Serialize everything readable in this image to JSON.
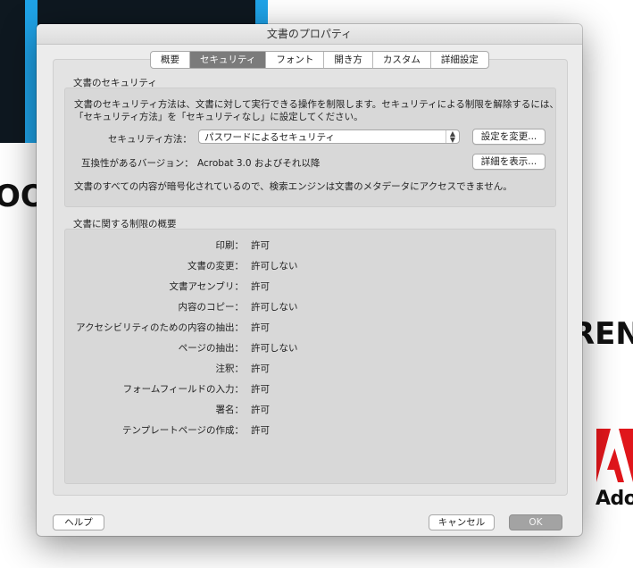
{
  "background": {
    "left_text": "OO",
    "right_text": "REN",
    "adobe_text": "Ado"
  },
  "dialog": {
    "title": "文書のプロパティ",
    "tabs": [
      {
        "label": "概要"
      },
      {
        "label": "セキュリティ",
        "active": true
      },
      {
        "label": "フォント"
      },
      {
        "label": "開き方"
      },
      {
        "label": "カスタム"
      },
      {
        "label": "詳細設定"
      }
    ],
    "security": {
      "heading": "文書のセキュリティ",
      "description_line1": "文書のセキュリティ方法は、文書に対して実行できる操作を制限します。セキュリティによる制限を解除するには、",
      "description_line2": "「セキュリティ方法」を「セキュリティなし」に設定してください。",
      "method_label": "セキュリティ方法：",
      "method_value": "パスワードによるセキュリティ",
      "change_settings_button": "設定を変更...",
      "compat_label": "互換性があるバージョン：",
      "compat_value": "Acrobat 3.0 およびそれ以降",
      "show_details_button": "詳細を表示...",
      "encryption_note": "文書のすべての内容が暗号化されているので、検索エンジンは文書のメタデータにアクセスできません。"
    },
    "restrictions": {
      "heading": "文書に関する制限の概要",
      "items": [
        {
          "label": "印刷：",
          "value": "許可"
        },
        {
          "label": "文書の変更：",
          "value": "許可しない"
        },
        {
          "label": "文書アセンブリ：",
          "value": "許可"
        },
        {
          "label": "内容のコピー：",
          "value": "許可しない"
        },
        {
          "label": "アクセシビリティのための内容の抽出：",
          "value": "許可"
        },
        {
          "label": "ページの抽出：",
          "value": "許可しない"
        },
        {
          "label": "注釈：",
          "value": "許可"
        },
        {
          "label": "フォームフィールドの入力：",
          "value": "許可"
        },
        {
          "label": "署名：",
          "value": "許可"
        },
        {
          "label": "テンプレートページの作成：",
          "value": "許可"
        }
      ]
    },
    "buttons": {
      "help": "ヘルプ",
      "cancel": "キャンセル",
      "ok": "OK"
    }
  }
}
